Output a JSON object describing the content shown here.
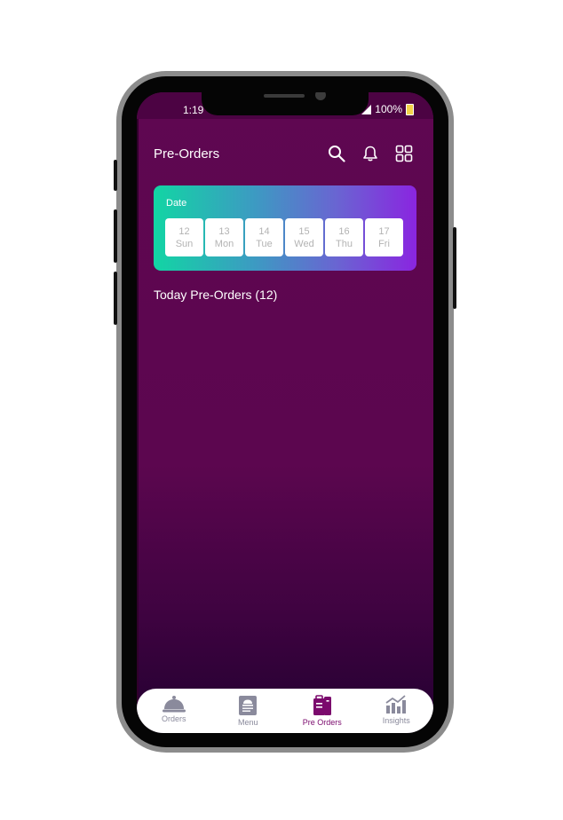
{
  "status_bar": {
    "time": "1:19",
    "battery": "100%"
  },
  "header": {
    "title": "Pre-Orders",
    "icons": [
      "search-icon",
      "bell-icon",
      "grid-icon"
    ]
  },
  "date_picker": {
    "label": "Date",
    "days": [
      {
        "day": "12",
        "weekday": "Sun"
      },
      {
        "day": "13",
        "weekday": "Mon"
      },
      {
        "day": "14",
        "weekday": "Tue"
      },
      {
        "day": "15",
        "weekday": "Wed"
      },
      {
        "day": "16",
        "weekday": "Thu"
      },
      {
        "day": "17",
        "weekday": "Fri"
      }
    ]
  },
  "section": {
    "title": "Today Pre-Orders (12)"
  },
  "bottom_nav": {
    "items": [
      {
        "label": "Orders",
        "icon": "bell-cloche-icon",
        "active": false
      },
      {
        "label": "Menu",
        "icon": "menu-card-icon",
        "active": false
      },
      {
        "label": "Pre Orders",
        "icon": "pre-orders-icon",
        "active": true
      },
      {
        "label": "Insights",
        "icon": "insights-chart-icon",
        "active": false
      }
    ]
  },
  "colors": {
    "background": "#5f0751",
    "accent": "#7b0a6d",
    "inactive_nav": "#8a8a9c",
    "gradient_start": "#12d5a4",
    "gradient_end": "#8a25e0"
  }
}
